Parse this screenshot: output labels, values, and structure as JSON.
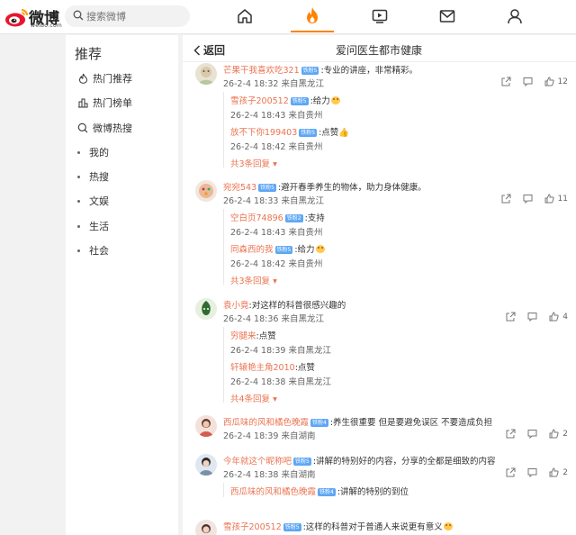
{
  "header": {
    "logo_text": "微博",
    "logo_sub": "weibo.com",
    "search_placeholder": "搜索微博"
  },
  "nav": [
    {
      "icon": "home-icon"
    },
    {
      "icon": "fire-icon",
      "active": true
    },
    {
      "icon": "video-icon"
    },
    {
      "icon": "mail-icon"
    },
    {
      "icon": "user-icon"
    }
  ],
  "sidebar": {
    "title": "推荐",
    "items": [
      {
        "label": "热门推荐",
        "icon": "flame-outline-icon"
      },
      {
        "label": "热门榜单",
        "icon": "ranking-icon"
      },
      {
        "label": "微博热搜",
        "icon": "search-icon"
      },
      {
        "label": "我的",
        "icon": "dot"
      },
      {
        "label": "热搜",
        "icon": "dot"
      },
      {
        "label": "文娱",
        "icon": "dot"
      },
      {
        "label": "生活",
        "icon": "dot"
      },
      {
        "label": "社会",
        "icon": "dot"
      }
    ]
  },
  "main": {
    "back_label": "返回",
    "title": "爱问医生都市健康"
  },
  "badge_label": "铁粉5",
  "badge_label_2": "铁粉4",
  "badge_label_3": "铁粉2",
  "comments": [
    {
      "user": "芒果干我喜欢吃321",
      "text": ":专业的讲座，非常精彩。",
      "meta": "26-2-4 18:32 来自黑龙江",
      "likes": "12",
      "replies": [
        {
          "user": "雪孩子200512",
          "text": ":给力",
          "meta": "26-2-4 18:43 来自贵州"
        },
        {
          "user": "放不下你199403",
          "text": ":点赞",
          "meta": "26-2-4 18:42 来自贵州"
        }
      ],
      "more": "共3条回复"
    },
    {
      "user": "宛宛543",
      "text": ":避开春季养生的物体，助力身体健康。",
      "meta": "26-2-4 18:33 来自黑龙江",
      "likes": "11",
      "replies": [
        {
          "user": "空白页74896",
          "text": ":支持",
          "meta": "26-2-4 18:43 来自贵州"
        },
        {
          "user": "同森西的我",
          "text": ":给力",
          "meta": "26-2-4 18:42 来自贵州"
        }
      ],
      "more": "共3条回复"
    },
    {
      "user": "袁小竟",
      "text": ":对这样的科普很感兴趣的",
      "meta": "26-2-4 18:36 来自黑龙江",
      "likes": "4",
      "replies": [
        {
          "user": "穷腿来",
          "text": ":点赞",
          "meta": "26-2-4 18:39 来自黑龙江"
        },
        {
          "user": "轩辕艳主角2010",
          "text": ":点赞",
          "meta": "26-2-4 18:38 来自黑龙江"
        }
      ],
      "more": "共4条回复"
    },
    {
      "user": "西瓜味的风和橘色晚霞",
      "text": ":养生很重要 但是要避免误区 不要造成负担",
      "meta": "26-2-4 18:39 来自湖南",
      "likes": "2"
    },
    {
      "user": "今年就这个昵称吧",
      "text": ":讲解的特别好的内容，分享的全都是细致的内容",
      "meta": "26-2-4 18:38 来自湖南",
      "likes": "2",
      "replies": [
        {
          "user": "西瓜味的风和橘色晚霞",
          "text": ":讲解的特别的到位",
          "meta": ""
        }
      ]
    },
    {
      "user": "雪孩子200512",
      "text": ":这样的科普对于普通人来说更有意义",
      "meta": "",
      "likes": ""
    }
  ],
  "colors": {
    "accent": "#ff8200",
    "username": "#eb7350",
    "badge": "#5ea7f5"
  }
}
